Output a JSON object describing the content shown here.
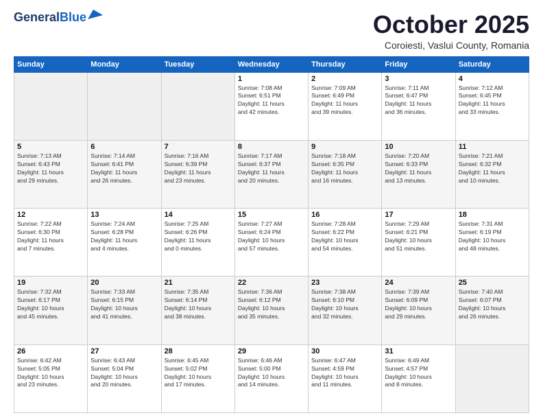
{
  "header": {
    "logo_line1": "General",
    "logo_line2": "Blue",
    "month": "October 2025",
    "location": "Coroiesti, Vaslui County, Romania"
  },
  "weekdays": [
    "Sunday",
    "Monday",
    "Tuesday",
    "Wednesday",
    "Thursday",
    "Friday",
    "Saturday"
  ],
  "weeks": [
    [
      {
        "day": "",
        "info": ""
      },
      {
        "day": "",
        "info": ""
      },
      {
        "day": "",
        "info": ""
      },
      {
        "day": "1",
        "info": "Sunrise: 7:08 AM\nSunset: 6:51 PM\nDaylight: 11 hours\nand 42 minutes."
      },
      {
        "day": "2",
        "info": "Sunrise: 7:09 AM\nSunset: 6:49 PM\nDaylight: 11 hours\nand 39 minutes."
      },
      {
        "day": "3",
        "info": "Sunrise: 7:11 AM\nSunset: 6:47 PM\nDaylight: 11 hours\nand 36 minutes."
      },
      {
        "day": "4",
        "info": "Sunrise: 7:12 AM\nSunset: 6:45 PM\nDaylight: 11 hours\nand 33 minutes."
      }
    ],
    [
      {
        "day": "5",
        "info": "Sunrise: 7:13 AM\nSunset: 6:43 PM\nDaylight: 11 hours\nand 29 minutes."
      },
      {
        "day": "6",
        "info": "Sunrise: 7:14 AM\nSunset: 6:41 PM\nDaylight: 11 hours\nand 26 minutes."
      },
      {
        "day": "7",
        "info": "Sunrise: 7:16 AM\nSunset: 6:39 PM\nDaylight: 11 hours\nand 23 minutes."
      },
      {
        "day": "8",
        "info": "Sunrise: 7:17 AM\nSunset: 6:37 PM\nDaylight: 11 hours\nand 20 minutes."
      },
      {
        "day": "9",
        "info": "Sunrise: 7:18 AM\nSunset: 6:35 PM\nDaylight: 11 hours\nand 16 minutes."
      },
      {
        "day": "10",
        "info": "Sunrise: 7:20 AM\nSunset: 6:33 PM\nDaylight: 11 hours\nand 13 minutes."
      },
      {
        "day": "11",
        "info": "Sunrise: 7:21 AM\nSunset: 6:32 PM\nDaylight: 11 hours\nand 10 minutes."
      }
    ],
    [
      {
        "day": "12",
        "info": "Sunrise: 7:22 AM\nSunset: 6:30 PM\nDaylight: 11 hours\nand 7 minutes."
      },
      {
        "day": "13",
        "info": "Sunrise: 7:24 AM\nSunset: 6:28 PM\nDaylight: 11 hours\nand 4 minutes."
      },
      {
        "day": "14",
        "info": "Sunrise: 7:25 AM\nSunset: 6:26 PM\nDaylight: 11 hours\nand 0 minutes."
      },
      {
        "day": "15",
        "info": "Sunrise: 7:27 AM\nSunset: 6:24 PM\nDaylight: 10 hours\nand 57 minutes."
      },
      {
        "day": "16",
        "info": "Sunrise: 7:28 AM\nSunset: 6:22 PM\nDaylight: 10 hours\nand 54 minutes."
      },
      {
        "day": "17",
        "info": "Sunrise: 7:29 AM\nSunset: 6:21 PM\nDaylight: 10 hours\nand 51 minutes."
      },
      {
        "day": "18",
        "info": "Sunrise: 7:31 AM\nSunset: 6:19 PM\nDaylight: 10 hours\nand 48 minutes."
      }
    ],
    [
      {
        "day": "19",
        "info": "Sunrise: 7:32 AM\nSunset: 6:17 PM\nDaylight: 10 hours\nand 45 minutes."
      },
      {
        "day": "20",
        "info": "Sunrise: 7:33 AM\nSunset: 6:15 PM\nDaylight: 10 hours\nand 41 minutes."
      },
      {
        "day": "21",
        "info": "Sunrise: 7:35 AM\nSunset: 6:14 PM\nDaylight: 10 hours\nand 38 minutes."
      },
      {
        "day": "22",
        "info": "Sunrise: 7:36 AM\nSunset: 6:12 PM\nDaylight: 10 hours\nand 35 minutes."
      },
      {
        "day": "23",
        "info": "Sunrise: 7:38 AM\nSunset: 6:10 PM\nDaylight: 10 hours\nand 32 minutes."
      },
      {
        "day": "24",
        "info": "Sunrise: 7:39 AM\nSunset: 6:09 PM\nDaylight: 10 hours\nand 29 minutes."
      },
      {
        "day": "25",
        "info": "Sunrise: 7:40 AM\nSunset: 6:07 PM\nDaylight: 10 hours\nand 26 minutes."
      }
    ],
    [
      {
        "day": "26",
        "info": "Sunrise: 6:42 AM\nSunset: 5:05 PM\nDaylight: 10 hours\nand 23 minutes."
      },
      {
        "day": "27",
        "info": "Sunrise: 6:43 AM\nSunset: 5:04 PM\nDaylight: 10 hours\nand 20 minutes."
      },
      {
        "day": "28",
        "info": "Sunrise: 6:45 AM\nSunset: 5:02 PM\nDaylight: 10 hours\nand 17 minutes."
      },
      {
        "day": "29",
        "info": "Sunrise: 6:46 AM\nSunset: 5:00 PM\nDaylight: 10 hours\nand 14 minutes."
      },
      {
        "day": "30",
        "info": "Sunrise: 6:47 AM\nSunset: 4:59 PM\nDaylight: 10 hours\nand 11 minutes."
      },
      {
        "day": "31",
        "info": "Sunrise: 6:49 AM\nSunset: 4:57 PM\nDaylight: 10 hours\nand 8 minutes."
      },
      {
        "day": "",
        "info": ""
      }
    ]
  ]
}
